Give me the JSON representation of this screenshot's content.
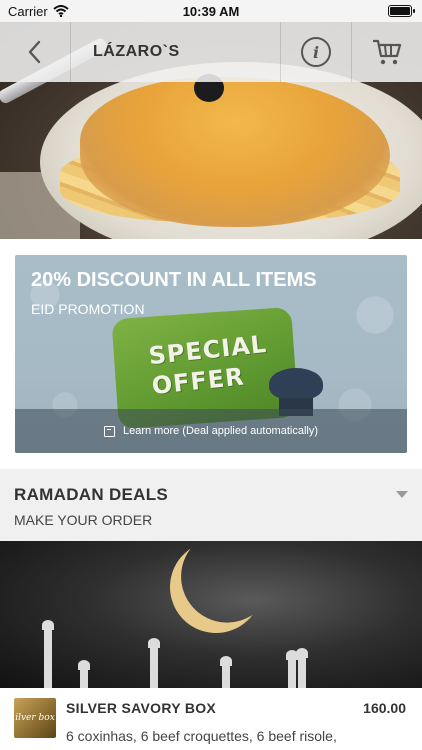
{
  "status_bar": {
    "carrier": "Carrier",
    "time": "10:39 AM"
  },
  "nav": {
    "title": "LÁZARO`S",
    "back_icon": "chevron-left-icon",
    "info_icon": "info-icon",
    "cart_icon": "cart-icon",
    "info_glyph": "i"
  },
  "promo": {
    "title": "20% DISCOUNT IN ALL ITEMS",
    "subtitle": "EID PROMOTION",
    "badge_line1": "SPECIAL",
    "badge_line2": "OFFER",
    "footer_text": "Learn more (Deal applied automatically)"
  },
  "section": {
    "title": "RAMADAN DEALS",
    "subtitle": "MAKE YOUR ORDER"
  },
  "product": {
    "thumb_text": "ilver box",
    "name": "SILVER SAVORY BOX",
    "price": "160.00",
    "description": "6 coxinhas, 6 beef croquettes, 6 beef risole,"
  },
  "colors": {
    "accent_green": "#6aa33a",
    "promo_bg": "#a9bdc9",
    "section_bg": "#f0f0f0"
  }
}
